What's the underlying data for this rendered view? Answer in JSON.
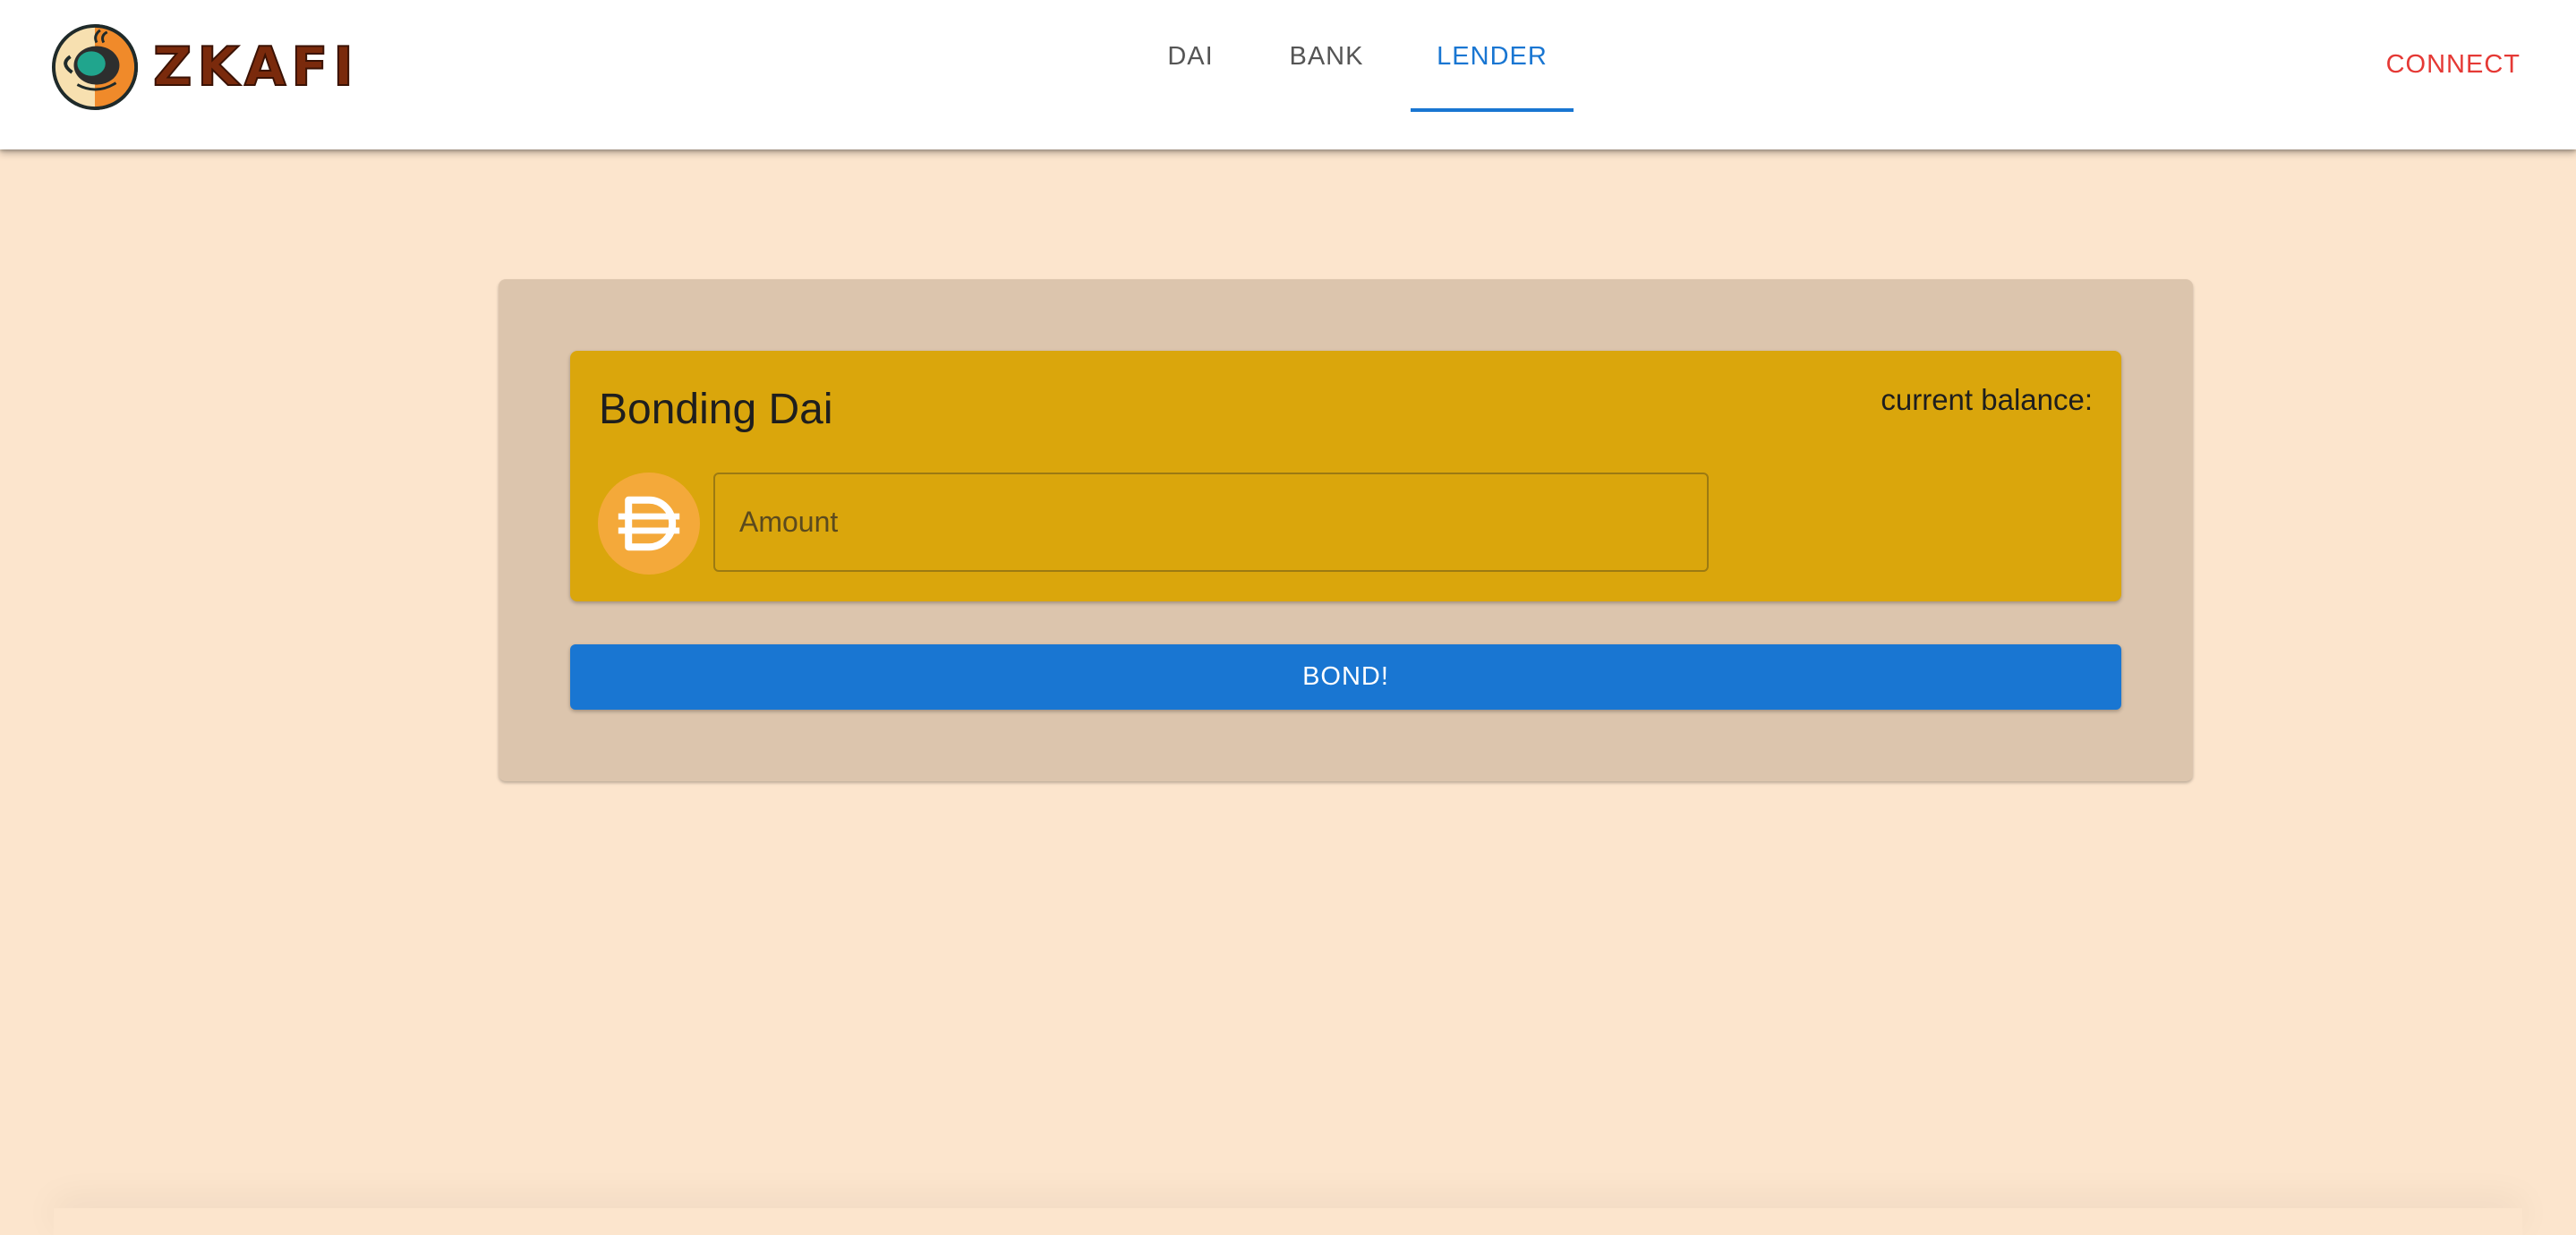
{
  "brand": {
    "name": "ZKAFI",
    "logo_icon": "coffee-cup-logo-icon"
  },
  "nav": {
    "tabs": [
      {
        "label": "DAI"
      },
      {
        "label": "BANK"
      },
      {
        "label": "LENDER"
      }
    ],
    "active_tab": "LENDER",
    "connect_label": "CONNECT"
  },
  "bond_card": {
    "title": "Bonding Dai",
    "balance_label": "current balance:",
    "token_icon": "dai-icon",
    "amount_placeholder": "Amount",
    "amount_value": ""
  },
  "actions": {
    "bond_label": "BOND!"
  },
  "colors": {
    "page_bg": "#fce5cd",
    "panel_bg": "#dcc5ad",
    "card_bg": "#daa60c",
    "accent": "#1976d2",
    "connect": "#e53935",
    "dai_badge": "#f4a93a"
  }
}
